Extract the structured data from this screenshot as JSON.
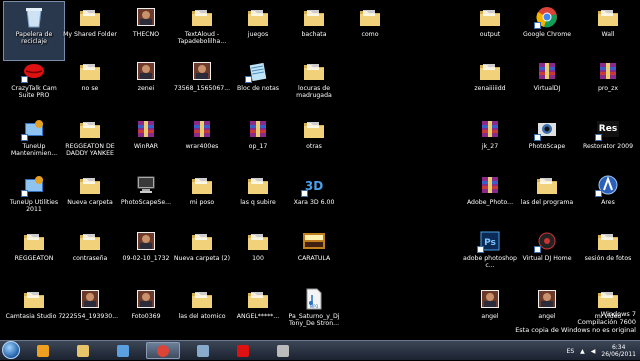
{
  "desktop": {
    "icons": [
      {
        "id": "recycle-bin",
        "label": "Papelera de reciclaje",
        "col": 0,
        "row": 0,
        "type": "bin",
        "selected": true
      },
      {
        "id": "my-shared-folder",
        "label": "My Shared Folder",
        "col": 1,
        "row": 0,
        "type": "folder"
      },
      {
        "id": "thecno",
        "label": "THECNO",
        "col": 2,
        "row": 0,
        "type": "photo"
      },
      {
        "id": "textaloud",
        "label": "TextAloud - Tapadebolilha...",
        "col": 3,
        "row": 0,
        "type": "folder"
      },
      {
        "id": "juegos",
        "label": "juegos",
        "col": 4,
        "row": 0,
        "type": "folder"
      },
      {
        "id": "bachata",
        "label": "bachata",
        "col": 5,
        "row": 0,
        "type": "folder"
      },
      {
        "id": "como",
        "label": "como",
        "col": 6,
        "row": 0,
        "type": "folder"
      },
      {
        "id": "output",
        "label": "output",
        "col": 8,
        "row": 0,
        "type": "folder"
      },
      {
        "id": "google-chrome",
        "label": "Google Chrome",
        "col": 9,
        "row": 0,
        "type": "chrome",
        "shortcut": true
      },
      {
        "id": "wall",
        "label": "Wall",
        "col": 10,
        "row": 0,
        "type": "folder"
      },
      {
        "id": "crazytalk",
        "label": "CrazyTalk Cam Suite PRO",
        "col": 0,
        "row": 1,
        "type": "lips",
        "shortcut": true
      },
      {
        "id": "no-se",
        "label": "no se",
        "col": 1,
        "row": 1,
        "type": "folder"
      },
      {
        "id": "zenei",
        "label": "zenei",
        "col": 2,
        "row": 1,
        "type": "photo"
      },
      {
        "id": "file-73568",
        "label": "73568_1565067...",
        "col": 3,
        "row": 1,
        "type": "photo"
      },
      {
        "id": "bloc-de-notas",
        "label": "Bloc de notas",
        "col": 4,
        "row": 1,
        "type": "notepad",
        "shortcut": true
      },
      {
        "id": "locuras",
        "label": "locuras de madrugada",
        "col": 5,
        "row": 1,
        "type": "folder"
      },
      {
        "id": "zenaiiiiidd",
        "label": "zenaiiiiidd",
        "col": 8,
        "row": 1,
        "type": "folder"
      },
      {
        "id": "virtualdj",
        "label": "VirtualDJ",
        "col": 9,
        "row": 1,
        "type": "rar"
      },
      {
        "id": "pro-zx",
        "label": "pro_zx",
        "col": 10,
        "row": 1,
        "type": "rar"
      },
      {
        "id": "tuneup-mant",
        "label": "TuneUp Mantenimien...",
        "col": 0,
        "row": 2,
        "type": "tuneup",
        "shortcut": true
      },
      {
        "id": "reggeaton-daddy",
        "label": "REGGEATON DE DADDY YANKEE",
        "col": 1,
        "row": 2,
        "type": "folder"
      },
      {
        "id": "winrar",
        "label": "WinRAR",
        "col": 2,
        "row": 2,
        "type": "rar"
      },
      {
        "id": "wrar400es",
        "label": "wrar400es",
        "col": 3,
        "row": 2,
        "type": "rar"
      },
      {
        "id": "op-17",
        "label": "op_17",
        "col": 4,
        "row": 2,
        "type": "rar"
      },
      {
        "id": "otras",
        "label": "otras",
        "col": 5,
        "row": 2,
        "type": "folder"
      },
      {
        "id": "jk-27",
        "label": "jk_27",
        "col": 8,
        "row": 2,
        "type": "rar"
      },
      {
        "id": "photoscape",
        "label": "PhotoScape",
        "col": 9,
        "row": 2,
        "type": "photoscape",
        "shortcut": true
      },
      {
        "id": "restorator",
        "label": "Restorator 2009",
        "col": 10,
        "row": 2,
        "type": "res",
        "shortcut": true
      },
      {
        "id": "tuneup-utilities",
        "label": "TuneUp Utilities 2011",
        "col": 0,
        "row": 3,
        "type": "tuneup",
        "shortcut": true
      },
      {
        "id": "nueva-carpeta",
        "label": "Nueva carpeta",
        "col": 1,
        "row": 3,
        "type": "folder"
      },
      {
        "id": "photoscapese",
        "label": "PhotoScapeSe...",
        "col": 2,
        "row": 3,
        "type": "computer"
      },
      {
        "id": "mi-poso",
        "label": "mi poso",
        "col": 3,
        "row": 3,
        "type": "folder"
      },
      {
        "id": "las-q-subire",
        "label": "las q subire",
        "col": 4,
        "row": 3,
        "type": "folder"
      },
      {
        "id": "xara-3d",
        "label": "Xara 3D 6.00",
        "col": 5,
        "row": 3,
        "type": "xara",
        "shortcut": true
      },
      {
        "id": "adobe-photo",
        "label": "Adobe_Photo...",
        "col": 8,
        "row": 3,
        "type": "rar"
      },
      {
        "id": "las-del-programa",
        "label": "las del programa",
        "col": 9,
        "row": 3,
        "type": "folder"
      },
      {
        "id": "ares",
        "label": "Ares",
        "col": 10,
        "row": 3,
        "type": "ares",
        "shortcut": true
      },
      {
        "id": "reggeaton",
        "label": "REGGEATON",
        "col": 0,
        "row": 4,
        "type": "folder"
      },
      {
        "id": "contrasena",
        "label": "contraseña",
        "col": 1,
        "row": 4,
        "type": "folder"
      },
      {
        "id": "file-09-02",
        "label": "09-02-10_1732",
        "col": 2,
        "row": 4,
        "type": "photo"
      },
      {
        "id": "nueva-carpeta-2",
        "label": "Nueva carpeta (2)",
        "col": 3,
        "row": 4,
        "type": "folder"
      },
      {
        "id": "cien",
        "label": "100",
        "col": 4,
        "row": 4,
        "type": "folder"
      },
      {
        "id": "caratula",
        "label": "CARATULA",
        "col": 5,
        "row": 4,
        "type": "caratula"
      },
      {
        "id": "adobe-photoshop",
        "label": "adobe photoshop c...",
        "col": 8,
        "row": 4,
        "type": "ps",
        "shortcut": true
      },
      {
        "id": "virtual-dj-home",
        "label": "Virtual DJ Home",
        "col": 9,
        "row": 4,
        "type": "vdj",
        "shortcut": true
      },
      {
        "id": "sesion-de-fotos",
        "label": "sesión de fotos",
        "col": 10,
        "row": 4,
        "type": "folder"
      },
      {
        "id": "camtasia",
        "label": "Camtasia Studio 7",
        "col": 0,
        "row": 5,
        "type": "folder"
      },
      {
        "id": "file-222554",
        "label": "222554_193930...",
        "col": 1,
        "row": 5,
        "type": "photo"
      },
      {
        "id": "foto0369",
        "label": "Foto0369",
        "col": 2,
        "row": 5,
        "type": "photo"
      },
      {
        "id": "las-del-atomico",
        "label": "las del atomico",
        "col": 3,
        "row": 5,
        "type": "folder"
      },
      {
        "id": "angel-stars",
        "label": "ANGEL*****...",
        "col": 4,
        "row": 5,
        "type": "folder"
      },
      {
        "id": "pa-saturno",
        "label": "Pa_Saturno_y_Dj Tony_De Stron...",
        "col": 5,
        "row": 5,
        "type": "mp3"
      },
      {
        "id": "angel-1",
        "label": "angel",
        "col": 8,
        "row": 5,
        "type": "photo"
      },
      {
        "id": "angel-2",
        "label": "angel",
        "col": 9,
        "row": 5,
        "type": "photo"
      },
      {
        "id": "mi-video",
        "label": "mi video",
        "col": 10,
        "row": 5,
        "type": "folder"
      }
    ]
  },
  "watermark": {
    "line1": "Windows 7",
    "line2": "Compilación 7600",
    "line3": "Esta copia de Windows no es original"
  },
  "taskbar": {
    "items": [
      {
        "id": "media-player",
        "name": "windows-media-player-icon",
        "active": false
      },
      {
        "id": "explorer",
        "name": "windows-explorer-icon",
        "active": false
      },
      {
        "id": "control-panel",
        "name": "control-panel-icon",
        "active": false
      },
      {
        "id": "chrome",
        "name": "chrome-icon",
        "active": true
      },
      {
        "id": "paint",
        "name": "paint-icon",
        "active": false
      },
      {
        "id": "crazytalk",
        "name": "crazytalk-icon",
        "active": false
      },
      {
        "id": "app-7",
        "name": "app-icon",
        "active": false
      }
    ],
    "language": "ES",
    "time": "6:34",
    "date": "26/06/2011"
  },
  "colors": {
    "folder": "#e8c46a",
    "taskbar": "#1b2230",
    "accent": "#3a6fb0"
  }
}
